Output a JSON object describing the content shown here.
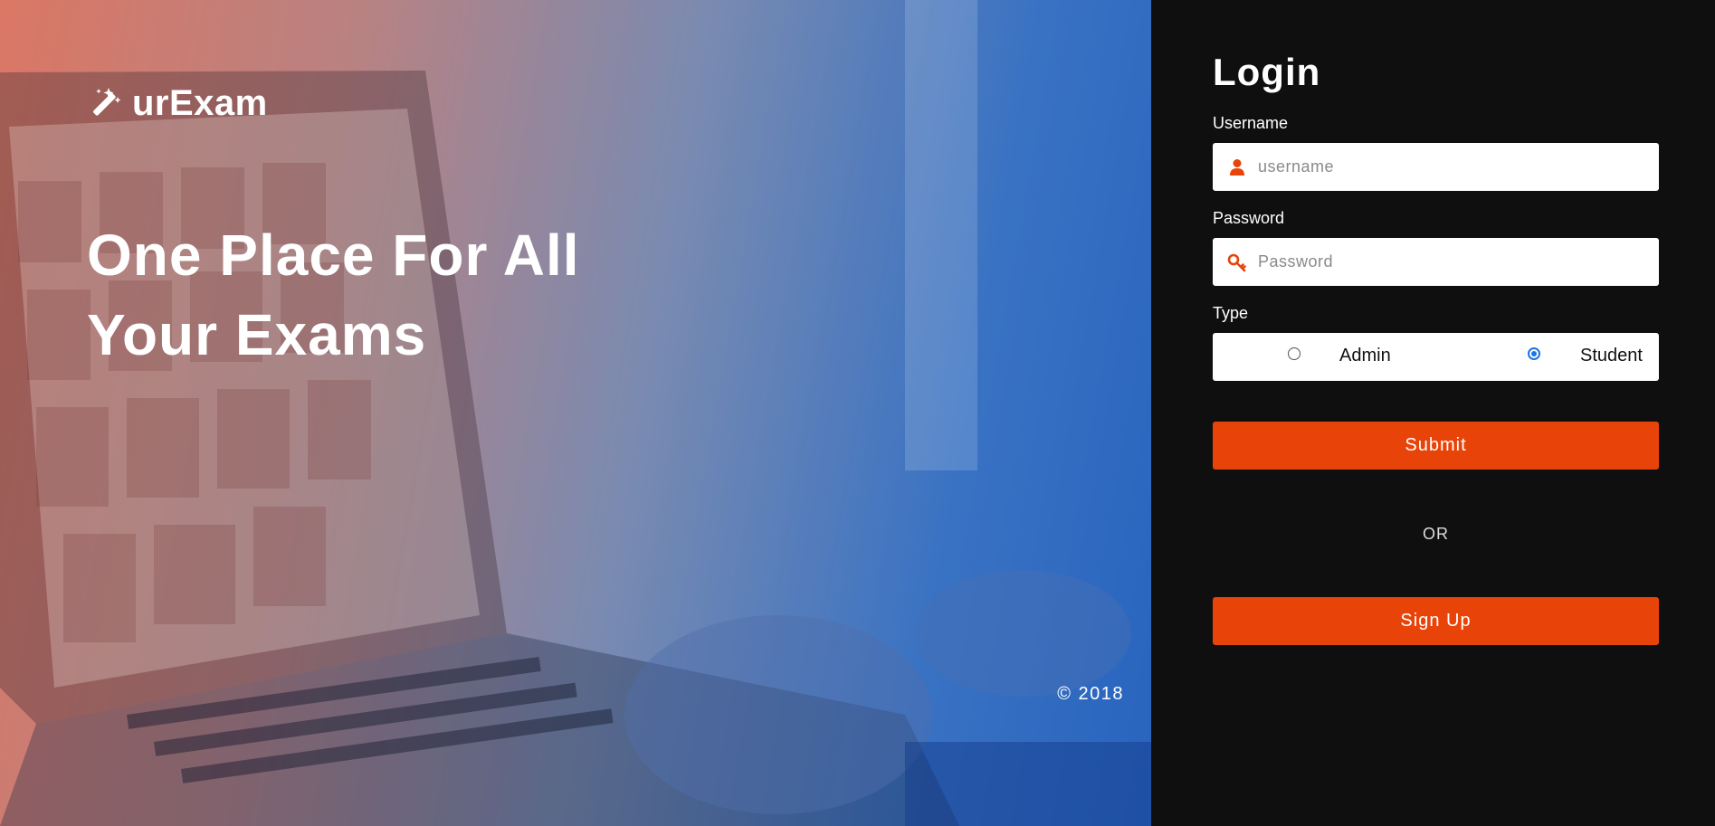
{
  "brand": {
    "name": "urExam",
    "icon": "magic-wand-icon"
  },
  "hero": {
    "headline_line1": "One Place For All",
    "headline_line2": "Your Exams",
    "copyright": "© 2018"
  },
  "login": {
    "title": "Login",
    "username_label": "Username",
    "username_placeholder": "username",
    "username_icon": "user-icon",
    "password_label": "Password",
    "password_placeholder": "Password",
    "password_icon": "key-icon",
    "type_label": "Type",
    "type_options": [
      {
        "label": "Admin",
        "selected": false
      },
      {
        "label": "Student",
        "selected": true
      }
    ],
    "submit_label": "Submit",
    "or_text": "OR",
    "signup_label": "Sign Up"
  },
  "colors": {
    "accent": "#e8440a",
    "panel_bg": "#0f0f0f",
    "radio_selected": "#1a73e8"
  }
}
